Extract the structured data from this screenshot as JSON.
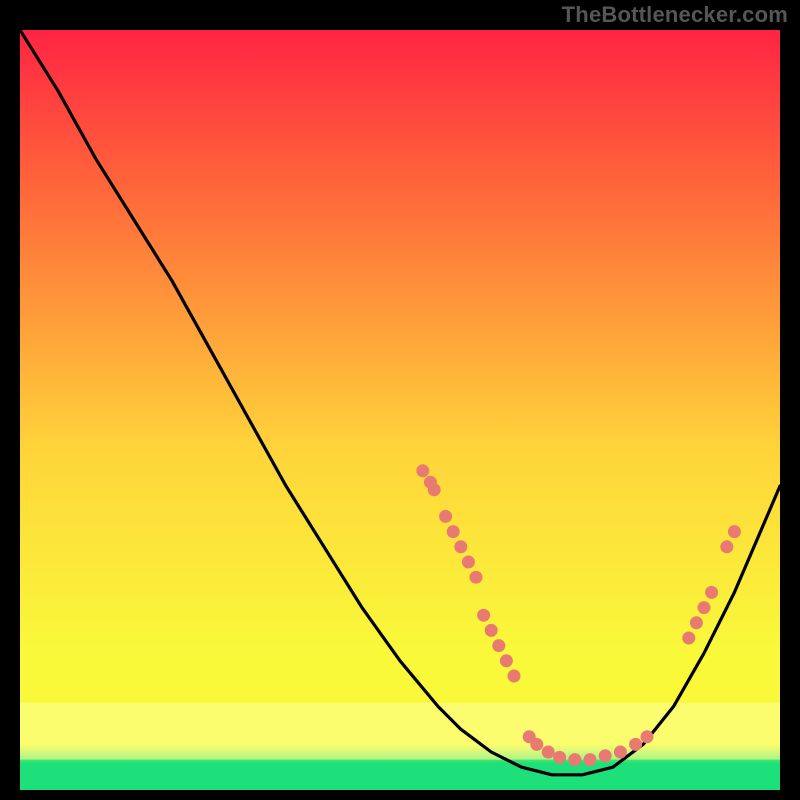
{
  "attribution": "TheBottlenecker.com",
  "chart_data": {
    "type": "line",
    "title": "",
    "xlabel": "",
    "ylabel": "",
    "xlim": [
      0,
      100
    ],
    "ylim": [
      0,
      100
    ],
    "background_gradient": {
      "top": "#ff2443",
      "upper": "#ff6a3a",
      "mid": "#ffd43a",
      "lower": "#f9f93a",
      "base": "#1ee07a"
    },
    "green_band": {
      "y_start": 96.5,
      "y_end": 100
    },
    "series": [
      {
        "name": "curve",
        "x": [
          0,
          5,
          10,
          15,
          20,
          25,
          30,
          35,
          40,
          45,
          50,
          55,
          58,
          62,
          66,
          70,
          74,
          78,
          82,
          86,
          90,
          94,
          97,
          100
        ],
        "y": [
          0,
          8,
          17,
          25,
          33,
          42,
          51,
          60,
          68,
          76,
          83,
          89,
          92,
          95,
          97,
          98,
          98,
          97,
          94,
          89,
          82,
          74,
          67,
          60
        ]
      }
    ],
    "dot_clusters": [
      {
        "name": "left-descent-upper",
        "points": [
          [
            53,
            58
          ],
          [
            54,
            59.5
          ],
          [
            54.5,
            60.5
          ]
        ]
      },
      {
        "name": "left-descent-mid",
        "points": [
          [
            56,
            64
          ],
          [
            57,
            66
          ],
          [
            58,
            68
          ],
          [
            59,
            70
          ],
          [
            60,
            72
          ]
        ]
      },
      {
        "name": "left-descent-lower",
        "points": [
          [
            61,
            77
          ],
          [
            62,
            79
          ],
          [
            63,
            81
          ],
          [
            64,
            83
          ],
          [
            65,
            85
          ]
        ]
      },
      {
        "name": "valley",
        "points": [
          [
            67,
            93
          ],
          [
            68,
            94
          ],
          [
            69.5,
            95
          ],
          [
            71,
            95.7
          ],
          [
            73,
            96
          ],
          [
            75,
            96
          ],
          [
            77,
            95.5
          ],
          [
            79,
            95
          ],
          [
            81,
            94
          ],
          [
            82.5,
            93
          ]
        ]
      },
      {
        "name": "right-ascent",
        "points": [
          [
            88,
            80
          ],
          [
            89,
            78
          ],
          [
            90,
            76
          ],
          [
            91,
            74
          ],
          [
            93,
            68
          ],
          [
            94,
            66
          ]
        ]
      }
    ],
    "colors": {
      "curve": "#000000",
      "dot_fill": "#e97a72",
      "dot_stroke": "#e97a72"
    }
  }
}
